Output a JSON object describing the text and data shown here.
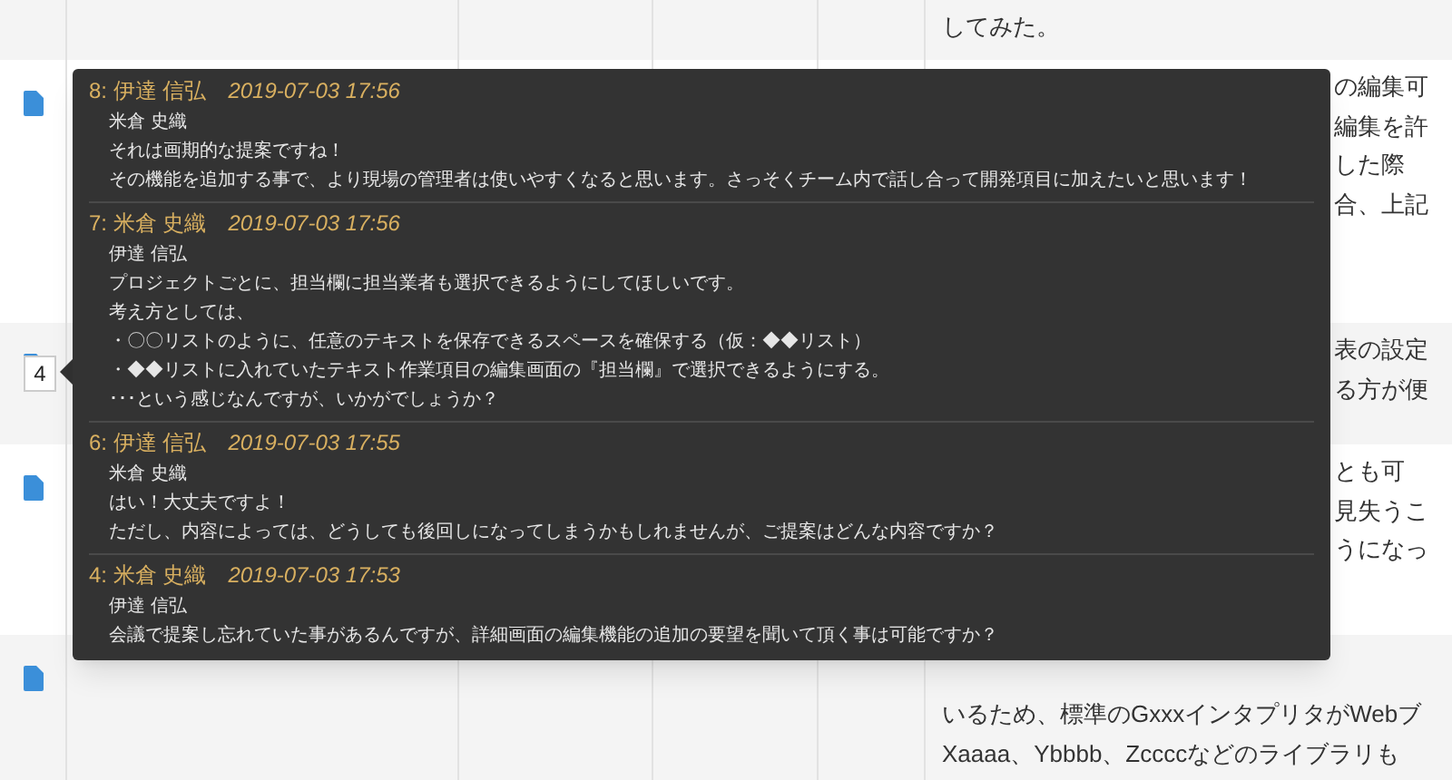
{
  "table": {
    "rows": [
      {
        "icon": false,
        "text_lines": [
          "してみた。"
        ]
      },
      {
        "icon": true,
        "text_lines": [
          "の編集可",
          "編集を許",
          "した際",
          "合、上記"
        ]
      },
      {
        "icon": true,
        "count": "4",
        "text_lines": [
          "表の設定",
          "る方が便"
        ]
      },
      {
        "icon": true,
        "text_lines": [
          "とも可",
          "見失うこ",
          "うになっ"
        ]
      },
      {
        "icon": true,
        "text_lines": [
          "いるため、標準のGxxxインタプリタがWebブ",
          "Xaaaa、Ybbbb、Zccccなどのライブラリも"
        ]
      }
    ]
  },
  "comments_popup": {
    "comments": [
      {
        "header": "8: 伊達 信弘",
        "time": "2019-07-03 17:56",
        "to": "米倉 史織",
        "lines": [
          "それは画期的な提案ですね！",
          "その機能を追加する事で、より現場の管理者は使いやすくなると思います。さっそくチーム内で話し合って開発項目に加えたいと思います！"
        ]
      },
      {
        "header": "7: 米倉 史織",
        "time": "2019-07-03 17:56",
        "to": "伊達 信弘",
        "lines": [
          "プロジェクトごとに、担当欄に担当業者も選択できるようにしてほしいです。",
          "考え方としては、",
          "・〇〇リストのように、任意のテキストを保存できるスペースを確保する（仮：◆◆リスト）",
          "・◆◆リストに入れていたテキスト作業項目の編集画面の『担当欄』で選択できるようにする。",
          "･･･という感じなんですが、いかがでしょうか？"
        ]
      },
      {
        "header": "6: 伊達 信弘",
        "time": "2019-07-03 17:55",
        "to": "米倉 史織",
        "lines": [
          "はい！大丈夫ですよ！",
          "ただし、内容によっては、どうしても後回しになってしまうかもしれませんが、ご提案はどんな内容ですか？"
        ]
      },
      {
        "header": "4: 米倉 史織",
        "time": "2019-07-03 17:53",
        "to": "伊達 信弘",
        "lines": [
          "会議で提案し忘れていた事があるんですが、詳細画面の編集機能の追加の要望を聞いて頂く事は可能ですか？"
        ]
      }
    ]
  }
}
